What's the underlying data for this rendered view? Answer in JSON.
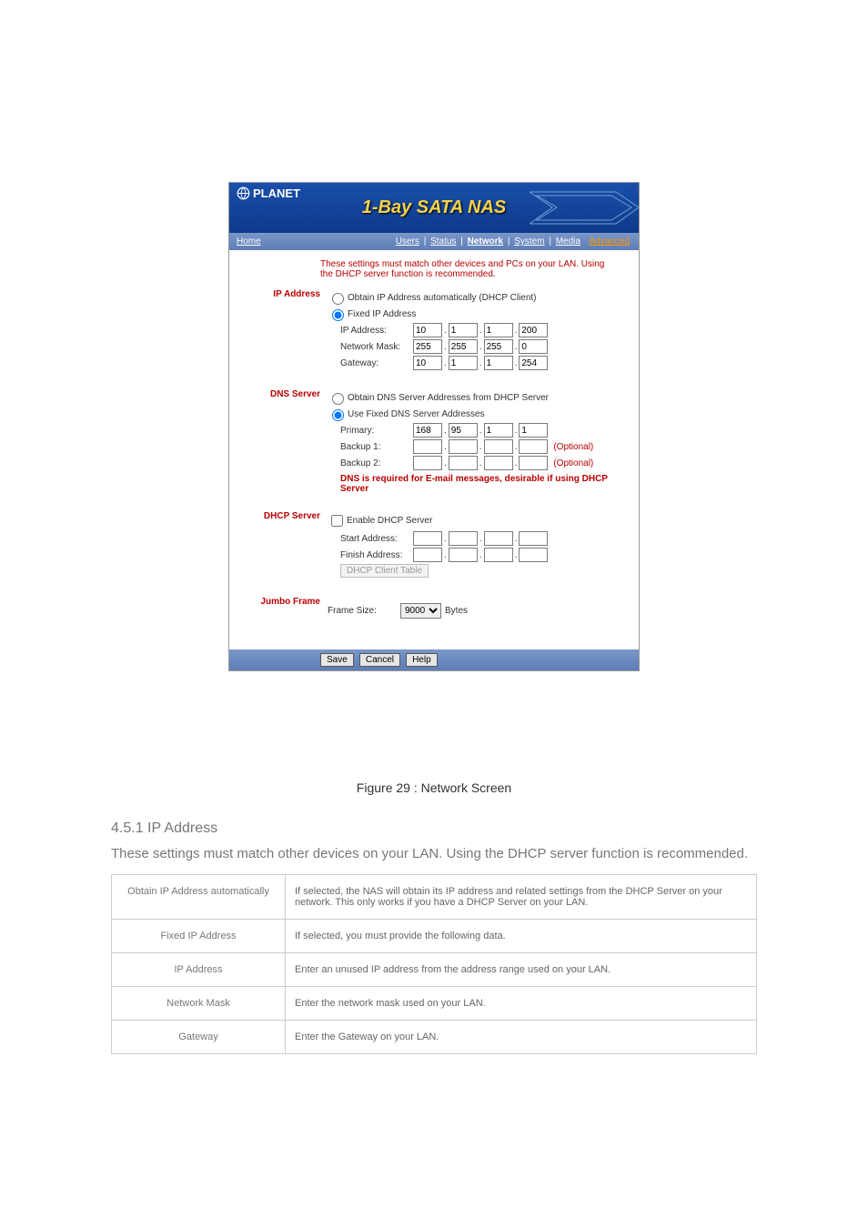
{
  "header": {
    "brand": "PLANET",
    "title": "1-Bay SATA NAS",
    "home": "Home",
    "nav": {
      "users": "Users",
      "status": "Status",
      "network": "Network",
      "system": "System",
      "media": "Media",
      "advanced": "Advanced"
    }
  },
  "hint": "These settings must match other devices and PCs on your LAN. Using the DHCP server function is recommended.",
  "ip": {
    "title": "IP Address",
    "dhcp_label": "Obtain IP Address automatically (DHCP Client)",
    "fixed_label": "Fixed IP Address",
    "ip_label": "IP Address:",
    "mask_label": "Network Mask:",
    "gateway_label": "Gateway:",
    "ip": [
      "10",
      "1",
      "1",
      "200"
    ],
    "mask": [
      "255",
      "255",
      "255",
      "0"
    ],
    "gw": [
      "10",
      "1",
      "1",
      "254"
    ]
  },
  "dns": {
    "title": "DNS Server",
    "dhcp_label": "Obtain DNS Server Addresses from DHCP Server",
    "fixed_label": "Use Fixed DNS Server Addresses",
    "primary_label": "Primary:",
    "backup1_label": "Backup 1:",
    "backup2_label": "Backup 2:",
    "optional": "(Optional)",
    "primary": [
      "168",
      "95",
      "1",
      "1"
    ],
    "backup1": [
      "",
      "",
      "",
      ""
    ],
    "backup2": [
      "",
      "",
      "",
      ""
    ],
    "note": "DNS is required for E-mail messages, desirable if using DHCP Server"
  },
  "dhcp": {
    "title": "DHCP Server",
    "enable_label": "Enable DHCP Server",
    "start_label": "Start Address:",
    "finish_label": "Finish Address:",
    "start": [
      "",
      "",
      "",
      ""
    ],
    "finish": [
      "",
      "",
      "",
      ""
    ],
    "client_btn": "DHCP Client Table"
  },
  "jumbo": {
    "title": "Jumbo Frame",
    "label": "Frame Size:",
    "value": "9000",
    "unit": "Bytes"
  },
  "buttons": {
    "save": "Save",
    "cancel": "Cancel",
    "help": "Help"
  },
  "figure": {
    "caption": "Figure 29 : Network Screen",
    "section": "4.5.1 IP Address",
    "intro": "These settings must match other devices on your LAN. Using the DHCP server function is recommended.",
    "rows": [
      {
        "c1": "Obtain IP Address automatically",
        "c2": "If selected, the NAS will obtain its IP address and related settings from the DHCP Server on your network. This only works if you have a DHCP Server on your LAN."
      },
      {
        "c1": "Fixed IP Address",
        "c2": "If selected, you must provide the following data."
      },
      {
        "c1": "IP Address",
        "c2": "Enter an unused IP address from the address range used on your LAN."
      },
      {
        "c1": "Network Mask",
        "c2": "Enter the network mask used on your LAN."
      },
      {
        "c1": "Gateway",
        "c2": "Enter the Gateway on your LAN."
      }
    ]
  }
}
